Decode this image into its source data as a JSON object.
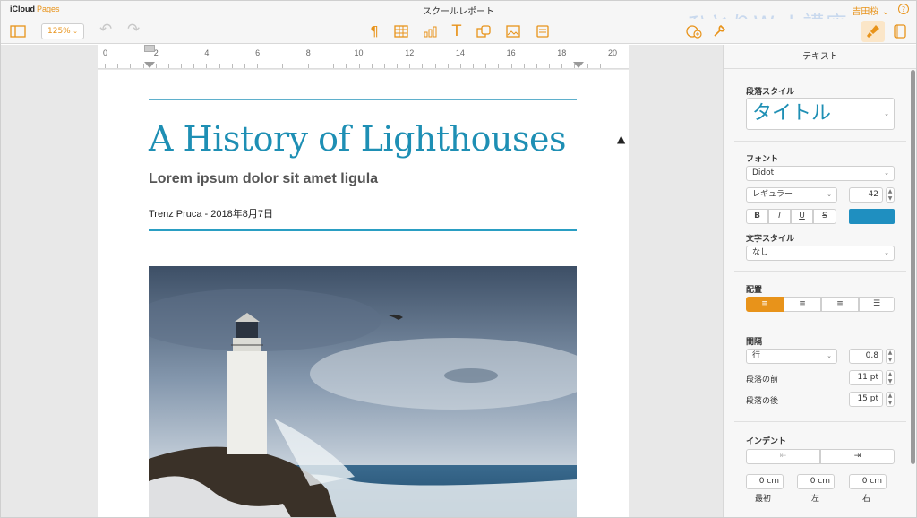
{
  "app": {
    "brand_a": "iCloud",
    "brand_b": "Pages",
    "doc_title": "スクールレポート",
    "user": "吉田桜",
    "help": "?",
    "watermark": "ひとりWeb講座"
  },
  "toolbar": {
    "zoom": "125%"
  },
  "ruler": {
    "ticks": [
      "0",
      "2",
      "4",
      "6",
      "8",
      "10",
      "12",
      "14",
      "16",
      "18",
      "20"
    ]
  },
  "document": {
    "title": "A History of Lighthouses",
    "subtitle": "Lorem ipsum dolor sit amet ligula",
    "author": "Trenz Pruca - 2018年8月7日"
  },
  "inspector": {
    "tab": "テキスト",
    "para_style_label": "段落スタイル",
    "para_style": "タイトル",
    "font_label": "フォント",
    "font": "Didot",
    "font_weight": "レギュラー",
    "font_size": "42",
    "bold": "B",
    "italic": "I",
    "underline": "U",
    "strike": "S",
    "text_color": "#1f8fc0",
    "char_style_label": "文字スタイル",
    "char_style": "なし",
    "align_label": "配置",
    "spacing_label": "間隔",
    "spacing_type": "行",
    "spacing_value": "0.8",
    "before_label": "段落の前",
    "before_value": "11 pt",
    "after_label": "段落の後",
    "after_value": "15 pt",
    "indent_label": "インデント",
    "indent_first": "0 cm",
    "indent_left": "0 cm",
    "indent_right": "0 cm",
    "first_label": "最初",
    "left_label": "左",
    "right_label": "右"
  },
  "colors": {
    "accent": "#e8931a",
    "title": "#1e8fb4"
  }
}
